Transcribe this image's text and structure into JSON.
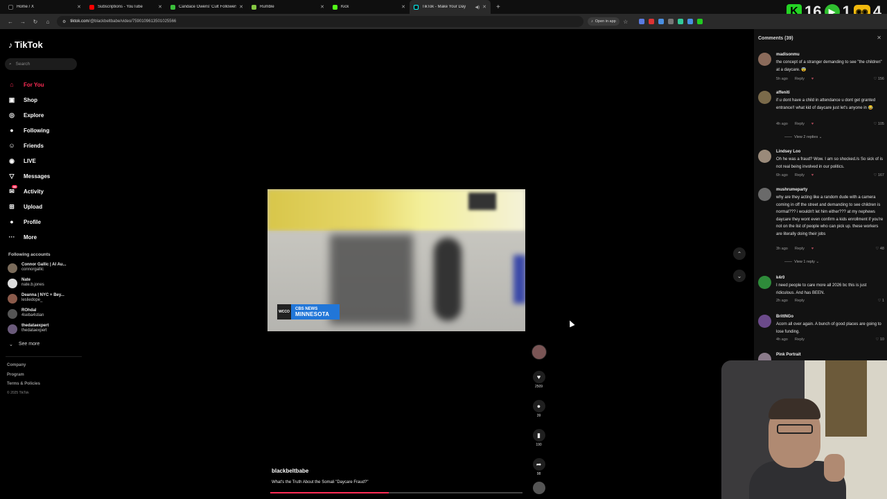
{
  "browser": {
    "tabs": [
      {
        "title": "Home / X",
        "color": "#000000",
        "letter": "X"
      },
      {
        "title": "Subscriptions - YouTube",
        "color": "#ff0000",
        "letter": "▶"
      },
      {
        "title": "Candace Owens' Cult Followers",
        "color": "#3bbf3b",
        "letter": "R"
      },
      {
        "title": "Rumble",
        "color": "#85c742",
        "letter": "▶"
      },
      {
        "title": "Kick",
        "color": "#53fc18",
        "letter": "K"
      },
      {
        "title": "TikTok - Make Your Day",
        "color": "#111111",
        "letter": "♪"
      }
    ],
    "url_site": "tiktok.com",
    "url_path": "/@blackbeltbabe/video/7590109613501025566",
    "open_in_app": "Open in app"
  },
  "overlay": {
    "count1": "16",
    "count2": "1",
    "count3": "4"
  },
  "nav": {
    "logo": "TikTok",
    "search_placeholder": "Search",
    "items": [
      {
        "label": "For You",
        "icon": "⌂"
      },
      {
        "label": "Shop",
        "icon": "▣"
      },
      {
        "label": "Explore",
        "icon": "◎"
      },
      {
        "label": "Following",
        "icon": "●"
      },
      {
        "label": "Friends",
        "icon": "☺"
      },
      {
        "label": "LIVE",
        "icon": "◉"
      },
      {
        "label": "Messages",
        "icon": "▽"
      },
      {
        "label": "Activity",
        "icon": "✉",
        "badge": "99"
      },
      {
        "label": "Upload",
        "icon": "⊞"
      },
      {
        "label": "Profile",
        "icon": "●"
      },
      {
        "label": "More",
        "icon": "···"
      }
    ],
    "following_heading": "Following accounts",
    "accounts": [
      {
        "name": "Connor Gallic | AI Au...",
        "handle": "connorgallic"
      },
      {
        "name": "Nate",
        "handle": "nate.b.jones"
      },
      {
        "name": "Deanna | NYC + Bey...",
        "handle": "lesliedope_"
      },
      {
        "name": "ROhdal",
        "handle": "4seba4stian"
      },
      {
        "name": "thedataexpert",
        "handle": "thedataexpert"
      }
    ],
    "see_more": "See more",
    "footer": [
      "Company",
      "Program",
      "Terms & Policies"
    ],
    "copyright": "© 2025 TikTok"
  },
  "video": {
    "chyron_station": "WCCO",
    "chyron_network": "CBS NEWS",
    "chyron_region": "MINNESOTA",
    "progress": 0.47
  },
  "actions": {
    "likes": "2509",
    "comments": "39",
    "saves": "190",
    "shares": "98"
  },
  "caption": {
    "user": "blackbeltbabe",
    "desc": "What's the Truth About the Somali \"Daycare Fraud?\""
  },
  "comments": {
    "header": "Comments (39)",
    "reply_label": "Reply",
    "items": [
      {
        "user": "madisonmu",
        "text": "the concept of a stranger demanding to see \"the children\" at a daycare. 😨",
        "time": "5h ago",
        "likes": "156"
      },
      {
        "user": "affeniti",
        "text": "if u dont have a child in attendance u dont get granted entrance!! what kid of daycare just let's anyone in 😂",
        "time": "4h ago",
        "likes": "105",
        "replies": "View 2 replies"
      },
      {
        "user": "Lindsey Loo",
        "text": "Oh he was a fraud? Wow. I am so shocked./s So sick of is not real being involved in our politics.",
        "time": "6h ago",
        "likes": "167"
      },
      {
        "user": "mushrumeparty",
        "text": "why are they acting like a random dude with a camera coming in off the street and demanding to see children is normal??? i wouldn't let him either??? at my nephews daycare they wont even confirm a kids enrollment if you're not on the list of people who can pick up. these workers are literally doing their jobs",
        "time": "3h ago",
        "likes": "48",
        "replies": "View 1 reply"
      },
      {
        "user": "k4r0",
        "text": "I need people to care more all 2026 bc this is just ridiculous. And has BEEN.",
        "time": "2h ago",
        "likes": "1"
      },
      {
        "user": "BrittNGo",
        "text": "Acorn all over again. A bunch of good places are going to lose funding.",
        "time": "4h ago",
        "likes": "10"
      },
      {
        "user": "Pink Portrait",
        "text": "",
        "time": "",
        "likes": ""
      }
    ]
  }
}
